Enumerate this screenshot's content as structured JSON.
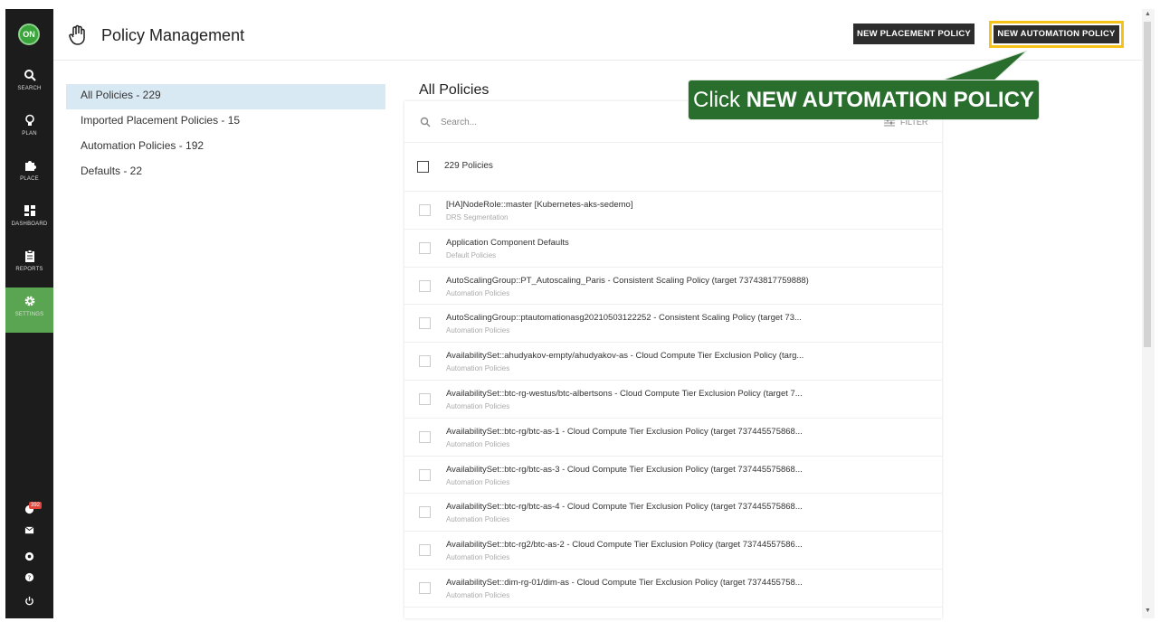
{
  "nav": {
    "logo": "ON",
    "items": [
      {
        "label": "SEARCH",
        "icon": "search-icon"
      },
      {
        "label": "PLAN",
        "icon": "lightbulb-icon"
      },
      {
        "label": "PLACE",
        "icon": "puzzle-icon"
      },
      {
        "label": "DASHBOARD",
        "icon": "dashboard-icon"
      },
      {
        "label": "REPORTS",
        "icon": "clipboard-icon"
      },
      {
        "label": "SETTINGS",
        "icon": "gear-icon"
      }
    ],
    "notification_count": "392",
    "bottom_icons": [
      "notification-icon",
      "mail-icon",
      "help-circle-icon",
      "question-icon",
      "power-icon"
    ],
    "active_color": "#5aa552"
  },
  "header": {
    "title": "Policy Management",
    "placement_button": "NEW PLACEMENT POLICY",
    "automation_button": "NEW AUTOMATION POLICY",
    "highlight_color": "#f5c218"
  },
  "filters": [
    {
      "label": "All Policies - 229",
      "active": true
    },
    {
      "label": "Imported Placement Policies - 15",
      "active": false
    },
    {
      "label": "Automation Policies - 192",
      "active": false
    },
    {
      "label": "Defaults - 22",
      "active": false
    }
  ],
  "main": {
    "title": "All Policies",
    "search_placeholder": "Search...",
    "filter_label": "FILTER",
    "count_label": "229 Policies",
    "rows": [
      {
        "title": "[HA]NodeRole::master [Kubernetes-aks-sedemo]",
        "subtitle": "DRS Segmentation"
      },
      {
        "title": "Application Component Defaults",
        "subtitle": "Default Policies"
      },
      {
        "title": "AutoScalingGroup::PT_Autoscaling_Paris - Consistent Scaling Policy (target 73743817759888)",
        "subtitle": "Automation Policies"
      },
      {
        "title": "AutoScalingGroup::ptautomationasg20210503122252 - Consistent Scaling Policy (target 73...",
        "subtitle": "Automation Policies"
      },
      {
        "title": "AvailabilitySet::ahudyakov-empty/ahudyakov-as - Cloud Compute Tier Exclusion Policy (targ...",
        "subtitle": "Automation Policies"
      },
      {
        "title": "AvailabilitySet::btc-rg-westus/btc-albertsons - Cloud Compute Tier Exclusion Policy (target 7...",
        "subtitle": "Automation Policies"
      },
      {
        "title": "AvailabilitySet::btc-rg/btc-as-1 - Cloud Compute Tier Exclusion Policy (target 737445575868...",
        "subtitle": "Automation Policies"
      },
      {
        "title": "AvailabilitySet::btc-rg/btc-as-3 - Cloud Compute Tier Exclusion Policy (target 737445575868...",
        "subtitle": "Automation Policies"
      },
      {
        "title": "AvailabilitySet::btc-rg/btc-as-4 - Cloud Compute Tier Exclusion Policy (target 737445575868...",
        "subtitle": "Automation Policies"
      },
      {
        "title": "AvailabilitySet::btc-rg2/btc-as-2 - Cloud Compute Tier Exclusion Policy (target 73744557586...",
        "subtitle": "Automation Policies"
      },
      {
        "title": "AvailabilitySet::dim-rg-01/dim-as - Cloud Compute Tier Exclusion Policy (target 7374455758...",
        "subtitle": "Automation Policies"
      }
    ]
  },
  "callout": {
    "prefix": "Click ",
    "emphasis": "NEW AUTOMATION POLICY",
    "color": "#2a6e2e"
  }
}
